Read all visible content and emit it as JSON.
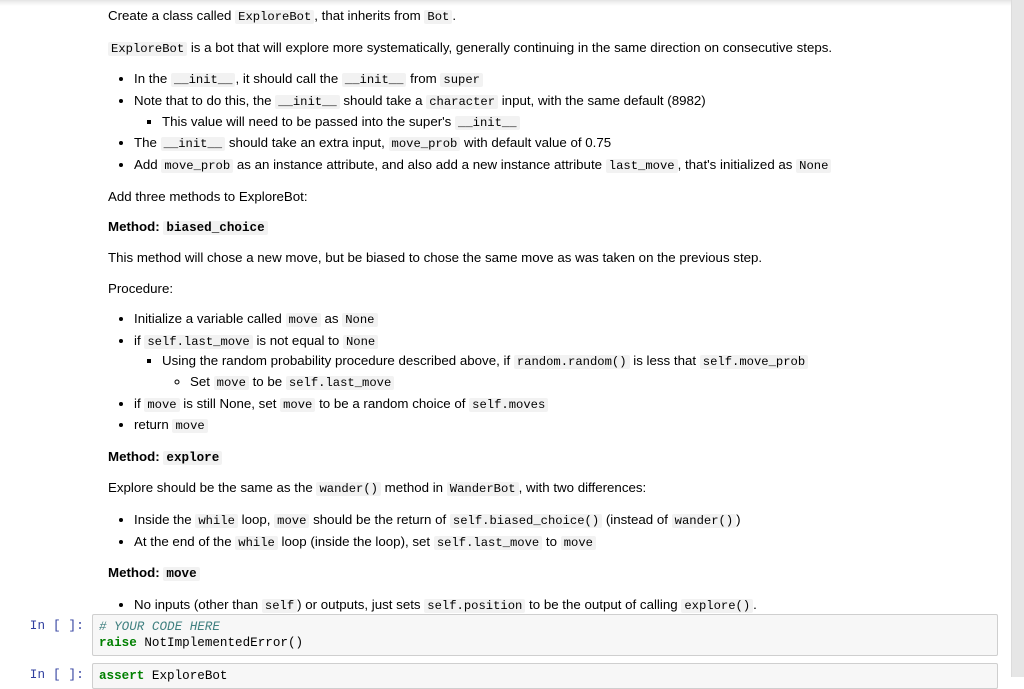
{
  "document": {
    "intro": {
      "line1_pre": "Create a class called ",
      "line1_code1": "ExploreBot",
      "line1_mid": ", that inherits from ",
      "line1_code2": "Bot",
      "line1_post": ".",
      "line2_code": "ExploreBot",
      "line2_text": "is a bot that will explore more systematically, generally continuing in the same direction on consecutive steps."
    },
    "init_bullets": {
      "b1_pre": "In the ",
      "b1_c1": "__init__",
      "b1_mid": ", it should call the ",
      "b1_c2": "__init__",
      "b1_mid2": " from ",
      "b1_c3": "super",
      "b2_pre": "Note that to do this, the ",
      "b2_c1": "__init__",
      "b2_mid": " should take a ",
      "b2_c2": "character",
      "b2_post": " input, with the same default (8982)",
      "b2_sub_pre": "This value will need to be passed into the super's ",
      "b2_sub_c1": "__init__",
      "b3_pre": "The ",
      "b3_c1": "__init__",
      "b3_mid": " should take an extra input, ",
      "b3_c2": "move_prob",
      "b3_post": " with default value of 0.75",
      "b4_pre": "Add ",
      "b4_c1": "move_prob",
      "b4_mid": " as an instance attribute, and also add a new instance attribute ",
      "b4_c2": "last_move",
      "b4_mid2": ", that's initialized as ",
      "b4_c3": "None"
    },
    "add_methods_text": "Add three methods to ExploreBot:",
    "method_biased_choice": {
      "heading_label": "Method: ",
      "heading_code": "biased_choice",
      "description": "This method will chose a new move, but be biased to chose the same move as was taken on the previous step.",
      "procedure_label": "Procedure:",
      "p1_pre": "Initialize a variable called ",
      "p1_c1": "move",
      "p1_mid": " as ",
      "p1_c2": "None",
      "p2_pre": "if ",
      "p2_c1": "self.last_move",
      "p2_mid": " is not equal to ",
      "p2_c2": "None",
      "p2_sub_pre": "Using the random probability procedure described above, if ",
      "p2_sub_c1": "random.random()",
      "p2_sub_mid": " is less that ",
      "p2_sub_c2": "self.move_prob",
      "p2_subsub_pre": "Set ",
      "p2_subsub_c1": "move",
      "p2_subsub_mid": " to be ",
      "p2_subsub_c2": "self.last_move",
      "p3_pre": "if ",
      "p3_c1": "move",
      "p3_mid": " is still None, set ",
      "p3_c2": "move",
      "p3_mid2": " to be a random choice of ",
      "p3_c3": "self.moves",
      "p4_pre": "return ",
      "p4_c1": "move"
    },
    "method_explore": {
      "heading_label": "Method: ",
      "heading_code": "explore",
      "desc_pre": "Explore should be the same as the ",
      "desc_c1": "wander()",
      "desc_mid": " method in ",
      "desc_c2": "WanderBot",
      "desc_post": ", with two differences:",
      "e1_pre": "Inside the ",
      "e1_c1": "while",
      "e1_mid": " loop, ",
      "e1_c2": "move",
      "e1_mid2": " should be the return of ",
      "e1_c3": "self.biased_choice()",
      "e1_mid3": " (instead of ",
      "e1_c4": "wander()",
      "e1_post": ")",
      "e2_pre": "At the end of the ",
      "e2_c1": "while",
      "e2_mid": " loop (inside the loop), set ",
      "e2_c2": "self.last_move",
      "e2_mid2": " to ",
      "e2_c3": "move"
    },
    "method_move": {
      "heading_label": "Method: ",
      "heading_code": "move",
      "m1_pre": "No inputs (other than ",
      "m1_c1": "self",
      "m1_mid": ") or outputs, just sets ",
      "m1_c2": "self.position",
      "m1_mid2": " to be the output of calling ",
      "m1_c3": "explore()",
      "m1_post": "."
    }
  },
  "code_cells": [
    {
      "prompt": "In [ ]:",
      "lines": [
        [
          {
            "t": "# YOUR CODE HERE",
            "c": "comment"
          }
        ],
        [
          {
            "t": "raise",
            "c": "keyword"
          },
          {
            "t": " NotImplementedError()",
            "c": "plain"
          }
        ]
      ]
    },
    {
      "prompt": "In [ ]:",
      "lines": [
        [
          {
            "t": "assert",
            "c": "keyword"
          },
          {
            "t": " ExploreBot",
            "c": "plain"
          }
        ]
      ]
    }
  ],
  "colors": {
    "page_background": "#ffffff",
    "code_cell_background": "#f7f7f7",
    "code_cell_border": "#cfcfcf",
    "inline_code_background": "#f2f2f2",
    "prompt_text": "#303F9F",
    "comment_token": "#408080",
    "keyword_token": "#008000",
    "scrollbar_track": "#e6e6e6"
  }
}
